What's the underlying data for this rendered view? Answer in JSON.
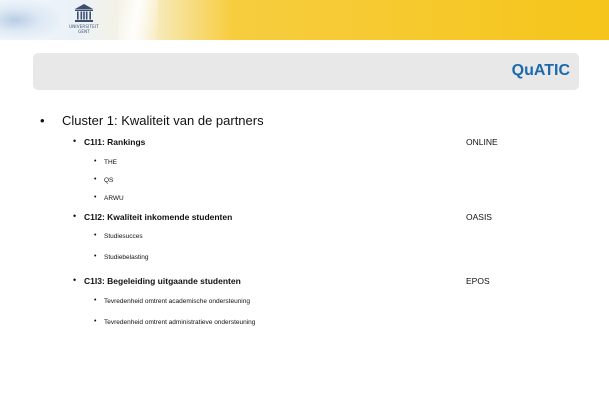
{
  "header": {
    "logo_lines": [
      "UNIVERSITEIT",
      "GENT"
    ],
    "title": "QuATIC"
  },
  "cluster": {
    "label": "Cluster 1: Kwaliteit van de partners",
    "indicators": [
      {
        "label": "C1I1: Rankings",
        "tag": "ONLINE",
        "items": [
          "THE",
          "QS",
          "ARWU"
        ]
      },
      {
        "label": "C1I2: Kwaliteit inkomende studenten",
        "tag": "OASIS",
        "items": [
          "Studiesucces",
          "Studiebelasting"
        ]
      },
      {
        "label": "C1I3: Begeleiding uitgaande studenten",
        "tag": "EPOS",
        "items": [
          "Tevredenheid omtrent academische ondersteuning",
          "Tevredenheid omtrent administratieve ondersteuning"
        ]
      }
    ]
  },
  "colors": {
    "title": "#1c6aab",
    "band_gold": "#f5c51a",
    "title_bar_bg": "#e8e8e8"
  },
  "icons": {
    "logo": "university-building-icon",
    "bullet": "•"
  }
}
